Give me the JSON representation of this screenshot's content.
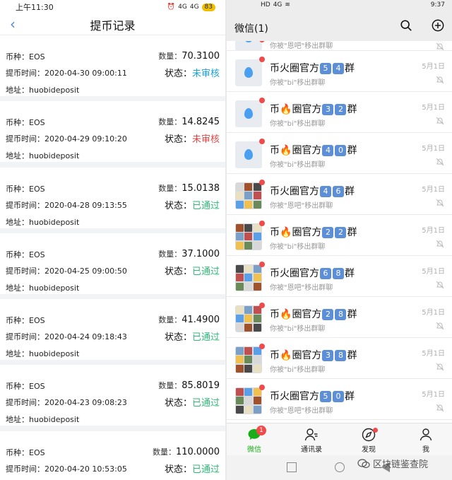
{
  "left": {
    "status": {
      "time": "上午11:30",
      "net1": "4G",
      "net2": "4G",
      "battery": "83"
    },
    "nav": {
      "back": "‹",
      "title": "提币记录"
    },
    "labels": {
      "coin": "币种：",
      "time": "提币时间：",
      "addr": "地址：",
      "qty": "数量：",
      "status": "状态："
    },
    "records": [
      {
        "coin": "EOS",
        "time": "2020-04-30 09:00:11",
        "addr": "huobideposit",
        "qty": "70.3100",
        "status": "未审核",
        "status_type": "pending-blue"
      },
      {
        "coin": "EOS",
        "time": "2020-04-29 09:10:20",
        "addr": "huobideposit",
        "qty": "14.8245",
        "status": "未审核",
        "status_type": "pending"
      },
      {
        "coin": "EOS",
        "time": "2020-04-28 09:13:55",
        "addr": "huobideposit",
        "qty": "15.0138",
        "status": "已通过",
        "status_type": "passed"
      },
      {
        "coin": "EOS",
        "time": "2020-04-25 09:00:50",
        "addr": "huobideposit",
        "qty": "37.1000",
        "status": "已通过",
        "status_type": "passed"
      },
      {
        "coin": "EOS",
        "time": "2020-04-24 09:18:43",
        "addr": "huobideposit",
        "qty": "41.4900",
        "status": "已通过",
        "status_type": "passed"
      },
      {
        "coin": "EOS",
        "time": "2020-04-23 09:08:23",
        "addr": "huobideposit",
        "qty": "85.8019",
        "status": "已通过",
        "status_type": "passed"
      },
      {
        "coin": "EOS",
        "time": "2020-04-20 10:53:05",
        "addr": "",
        "qty": "110.0000",
        "status": "已通过",
        "status_type": "passed"
      }
    ]
  },
  "right": {
    "status": {
      "hd": "HD",
      "net": "4G",
      "time": "9:37"
    },
    "topbar": {
      "title": "微信(1)"
    },
    "preview_text": "你被\"恩吧\"移出群聊",
    "preview_text_bi": "你被\"bi\"移出群聊",
    "chats": [
      {
        "pre": "币火圈官方",
        "fire": false,
        "n1": "5",
        "n2": "4",
        "suffix": "群",
        "preview": "bi",
        "time": "5月1日",
        "avatar": "single"
      },
      {
        "pre": "币",
        "fire": true,
        "post": "圈官方",
        "n1": "3",
        "n2": "2",
        "suffix": "群",
        "preview": "bi",
        "time": "5月1日",
        "avatar": "single"
      },
      {
        "pre": "币",
        "fire": true,
        "post": "圈官方",
        "n1": "4",
        "n2": "0",
        "suffix": "群",
        "preview": "bi",
        "time": "5月1日",
        "avatar": "single"
      },
      {
        "pre": "币火圈官方",
        "fire": false,
        "n1": "4",
        "n2": "6",
        "suffix": "群",
        "preview": "en",
        "time": "5月1日",
        "avatar": "grid"
      },
      {
        "pre": "币",
        "fire": true,
        "post": "圈官方",
        "n1": "2",
        "n2": "2",
        "suffix": "群",
        "preview": "bi",
        "time": "5月1日",
        "avatar": "grid"
      },
      {
        "pre": "币火圈官方",
        "fire": false,
        "n1": "6",
        "n2": "8",
        "suffix": "群",
        "preview": "en",
        "time": "5月1日",
        "avatar": "grid"
      },
      {
        "pre": "币",
        "fire": true,
        "post": "圈官方",
        "n1": "2",
        "n2": "8",
        "suffix": "群",
        "preview": "bi",
        "time": "5月1日",
        "avatar": "grid"
      },
      {
        "pre": "币",
        "fire": true,
        "post": "圈官方",
        "n1": "3",
        "n2": "8",
        "suffix": "群",
        "preview": "bi",
        "time": "5月1日",
        "avatar": "grid"
      },
      {
        "pre": "币火圈官方",
        "fire": false,
        "n1": "5",
        "n2": "0",
        "suffix": "群",
        "preview": "en",
        "time": "5月1日",
        "avatar": "grid"
      }
    ],
    "tabs": [
      {
        "label": "微信",
        "badge": "1"
      },
      {
        "label": "通讯录"
      },
      {
        "label": "发现"
      },
      {
        "label": "我"
      }
    ],
    "watermark": "区块链鉴查院",
    "colors": {
      "active_tab": "#1aad19",
      "badge": "#f24a4a",
      "num_box": "#5c8fd8"
    }
  }
}
